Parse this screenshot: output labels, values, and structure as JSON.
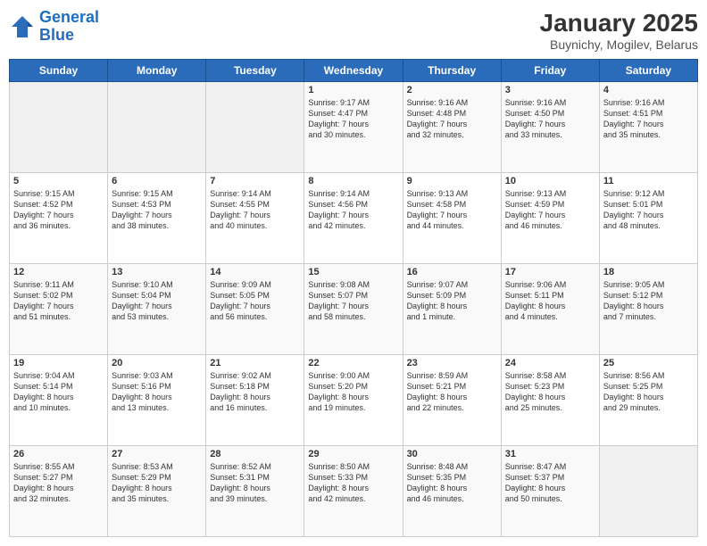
{
  "logo": {
    "line1": "General",
    "line2": "Blue"
  },
  "title": "January 2025",
  "subtitle": "Buynichy, Mogilev, Belarus",
  "days_of_week": [
    "Sunday",
    "Monday",
    "Tuesday",
    "Wednesday",
    "Thursday",
    "Friday",
    "Saturday"
  ],
  "weeks": [
    [
      {
        "num": "",
        "text": ""
      },
      {
        "num": "",
        "text": ""
      },
      {
        "num": "",
        "text": ""
      },
      {
        "num": "1",
        "text": "Sunrise: 9:17 AM\nSunset: 4:47 PM\nDaylight: 7 hours\nand 30 minutes."
      },
      {
        "num": "2",
        "text": "Sunrise: 9:16 AM\nSunset: 4:48 PM\nDaylight: 7 hours\nand 32 minutes."
      },
      {
        "num": "3",
        "text": "Sunrise: 9:16 AM\nSunset: 4:50 PM\nDaylight: 7 hours\nand 33 minutes."
      },
      {
        "num": "4",
        "text": "Sunrise: 9:16 AM\nSunset: 4:51 PM\nDaylight: 7 hours\nand 35 minutes."
      }
    ],
    [
      {
        "num": "5",
        "text": "Sunrise: 9:15 AM\nSunset: 4:52 PM\nDaylight: 7 hours\nand 36 minutes."
      },
      {
        "num": "6",
        "text": "Sunrise: 9:15 AM\nSunset: 4:53 PM\nDaylight: 7 hours\nand 38 minutes."
      },
      {
        "num": "7",
        "text": "Sunrise: 9:14 AM\nSunset: 4:55 PM\nDaylight: 7 hours\nand 40 minutes."
      },
      {
        "num": "8",
        "text": "Sunrise: 9:14 AM\nSunset: 4:56 PM\nDaylight: 7 hours\nand 42 minutes."
      },
      {
        "num": "9",
        "text": "Sunrise: 9:13 AM\nSunset: 4:58 PM\nDaylight: 7 hours\nand 44 minutes."
      },
      {
        "num": "10",
        "text": "Sunrise: 9:13 AM\nSunset: 4:59 PM\nDaylight: 7 hours\nand 46 minutes."
      },
      {
        "num": "11",
        "text": "Sunrise: 9:12 AM\nSunset: 5:01 PM\nDaylight: 7 hours\nand 48 minutes."
      }
    ],
    [
      {
        "num": "12",
        "text": "Sunrise: 9:11 AM\nSunset: 5:02 PM\nDaylight: 7 hours\nand 51 minutes."
      },
      {
        "num": "13",
        "text": "Sunrise: 9:10 AM\nSunset: 5:04 PM\nDaylight: 7 hours\nand 53 minutes."
      },
      {
        "num": "14",
        "text": "Sunrise: 9:09 AM\nSunset: 5:05 PM\nDaylight: 7 hours\nand 56 minutes."
      },
      {
        "num": "15",
        "text": "Sunrise: 9:08 AM\nSunset: 5:07 PM\nDaylight: 7 hours\nand 58 minutes."
      },
      {
        "num": "16",
        "text": "Sunrise: 9:07 AM\nSunset: 5:09 PM\nDaylight: 8 hours\nand 1 minute."
      },
      {
        "num": "17",
        "text": "Sunrise: 9:06 AM\nSunset: 5:11 PM\nDaylight: 8 hours\nand 4 minutes."
      },
      {
        "num": "18",
        "text": "Sunrise: 9:05 AM\nSunset: 5:12 PM\nDaylight: 8 hours\nand 7 minutes."
      }
    ],
    [
      {
        "num": "19",
        "text": "Sunrise: 9:04 AM\nSunset: 5:14 PM\nDaylight: 8 hours\nand 10 minutes."
      },
      {
        "num": "20",
        "text": "Sunrise: 9:03 AM\nSunset: 5:16 PM\nDaylight: 8 hours\nand 13 minutes."
      },
      {
        "num": "21",
        "text": "Sunrise: 9:02 AM\nSunset: 5:18 PM\nDaylight: 8 hours\nand 16 minutes."
      },
      {
        "num": "22",
        "text": "Sunrise: 9:00 AM\nSunset: 5:20 PM\nDaylight: 8 hours\nand 19 minutes."
      },
      {
        "num": "23",
        "text": "Sunrise: 8:59 AM\nSunset: 5:21 PM\nDaylight: 8 hours\nand 22 minutes."
      },
      {
        "num": "24",
        "text": "Sunrise: 8:58 AM\nSunset: 5:23 PM\nDaylight: 8 hours\nand 25 minutes."
      },
      {
        "num": "25",
        "text": "Sunrise: 8:56 AM\nSunset: 5:25 PM\nDaylight: 8 hours\nand 29 minutes."
      }
    ],
    [
      {
        "num": "26",
        "text": "Sunrise: 8:55 AM\nSunset: 5:27 PM\nDaylight: 8 hours\nand 32 minutes."
      },
      {
        "num": "27",
        "text": "Sunrise: 8:53 AM\nSunset: 5:29 PM\nDaylight: 8 hours\nand 35 minutes."
      },
      {
        "num": "28",
        "text": "Sunrise: 8:52 AM\nSunset: 5:31 PM\nDaylight: 8 hours\nand 39 minutes."
      },
      {
        "num": "29",
        "text": "Sunrise: 8:50 AM\nSunset: 5:33 PM\nDaylight: 8 hours\nand 42 minutes."
      },
      {
        "num": "30",
        "text": "Sunrise: 8:48 AM\nSunset: 5:35 PM\nDaylight: 8 hours\nand 46 minutes."
      },
      {
        "num": "31",
        "text": "Sunrise: 8:47 AM\nSunset: 5:37 PM\nDaylight: 8 hours\nand 50 minutes."
      },
      {
        "num": "",
        "text": ""
      }
    ]
  ]
}
